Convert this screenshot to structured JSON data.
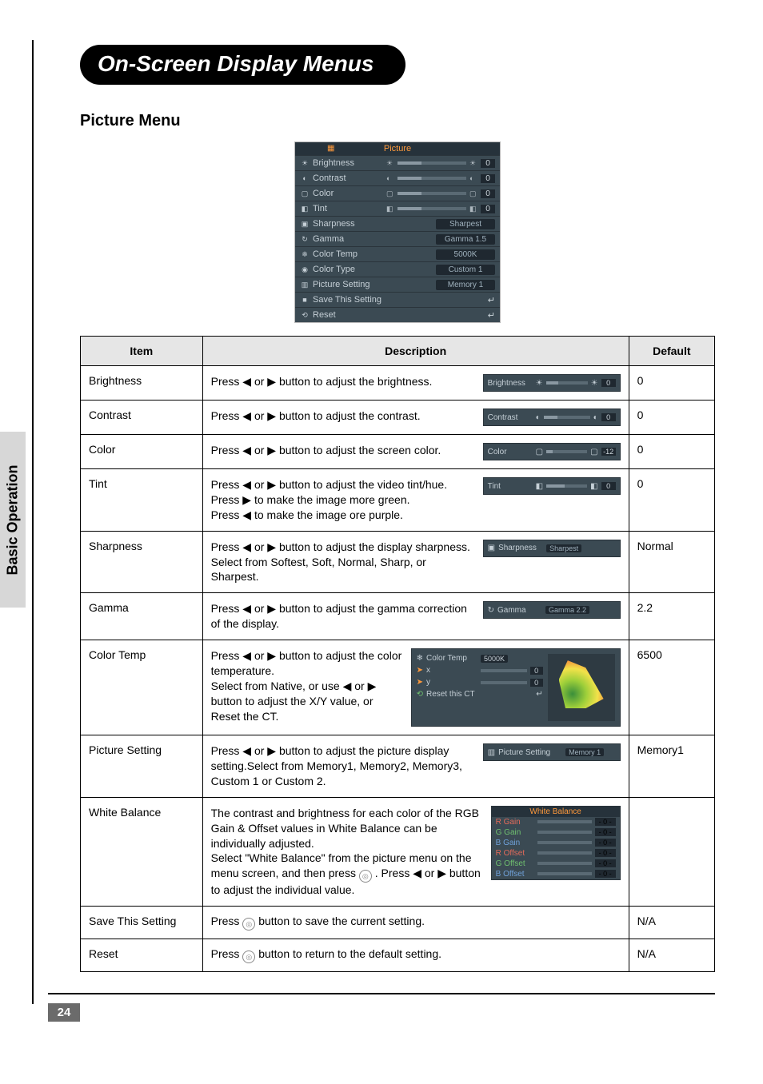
{
  "side_tab": "Basic Operation",
  "heading": "On-Screen Display Menus",
  "section": "Picture Menu",
  "page_number": "24",
  "icons": {
    "left": "◀",
    "right": "▶",
    "enter": "↵",
    "sun": "☀",
    "contrast": "◐",
    "square": "▢",
    "tint": "◧",
    "sharp": "▣",
    "gamma": "↻",
    "temp": "❄",
    "type": "◉",
    "setting": "▥",
    "save": "■",
    "reset": "⟲",
    "ok_circle": "◎"
  },
  "osd": {
    "title": "Picture",
    "rows": [
      {
        "kind": "slider",
        "iconL": "☀",
        "label": "Brightness",
        "iconR": "☀",
        "value": "0"
      },
      {
        "kind": "slider",
        "iconL": "◐",
        "label": "Contrast",
        "iconR": "◐",
        "value": "0"
      },
      {
        "kind": "slider",
        "iconL": "▢",
        "label": "Color",
        "iconR": "▢",
        "value": "0"
      },
      {
        "kind": "slider",
        "iconL": "◧",
        "label": "Tint",
        "iconR": "◧",
        "value": "0"
      },
      {
        "kind": "pill",
        "iconL": "▣",
        "label": "Sharpness",
        "pill": "Sharpest"
      },
      {
        "kind": "pill",
        "iconL": "↻",
        "label": "Gamma",
        "pill": "Gamma 1.5"
      },
      {
        "kind": "pill",
        "iconL": "❄",
        "label": "Color Temp",
        "pill": "5000K"
      },
      {
        "kind": "pill",
        "iconL": "◉",
        "label": "Color Type",
        "pill": "Custom 1"
      },
      {
        "kind": "pill",
        "iconL": "▥",
        "label": "Picture Setting",
        "pill": "Memory 1"
      },
      {
        "kind": "enter",
        "iconL": "■",
        "label": "Save This Setting"
      },
      {
        "kind": "enter",
        "iconL": "⟲",
        "label": "Reset"
      }
    ]
  },
  "table": {
    "headers": {
      "item": "Item",
      "desc": "Description",
      "def": "Default"
    },
    "rows": {
      "brightness": {
        "item": "Brightness",
        "desc": "Press ◀ or ▶ button to adjust the brightness.",
        "mini": {
          "label": "Brightness",
          "value": "0",
          "type": "slider"
        },
        "def": "0"
      },
      "contrast": {
        "item": "Contrast",
        "desc": "Press ◀ or ▶ button to adjust the contrast.",
        "mini": {
          "label": "Contrast",
          "value": "0",
          "type": "slider"
        },
        "def": "0"
      },
      "color": {
        "item": "Color",
        "desc": "Press ◀ or ▶ button to adjust the screen color.",
        "mini": {
          "label": "Color",
          "value": "-12",
          "type": "slider"
        },
        "def": "0"
      },
      "tint": {
        "item": "Tint",
        "desc": "Press ◀ or ▶ button to adjust the video tint/hue.\nPress ▶ to make the image more green.\nPress ◀ to make the image ore purple.",
        "mini": {
          "label": "Tint",
          "value": "0",
          "type": "slider"
        },
        "def": "0"
      },
      "sharpness": {
        "item": "Sharpness",
        "desc": "Press ◀ or ▶ button to adjust the display sharpness.\nSelect from Softest, Soft, Normal, Sharp, or Sharpest.",
        "mini": {
          "label": "Sharpness",
          "pill": "Sharpest",
          "type": "pill"
        },
        "def": "Normal"
      },
      "gamma": {
        "item": "Gamma",
        "desc": "Press ◀ or ▶ button to adjust the gamma correction of the display.",
        "mini": {
          "label": "Gamma",
          "pill": "Gamma 2.2",
          "type": "pill"
        },
        "def": "2.2"
      },
      "colortemp": {
        "item": "Color Temp",
        "desc": "Press ◀ or ▶ button to adjust the color temperature.\nSelect from Native, or use ◀ or ▶ button to adjust the X/Y value, or Reset the CT.",
        "def": "6500",
        "ct": {
          "row1": {
            "label": "Color Temp",
            "pill": "5000K"
          },
          "row2": {
            "label": "x",
            "value": "0"
          },
          "row3": {
            "label": "y",
            "value": "0"
          },
          "row4": {
            "label": "Reset this CT"
          }
        }
      },
      "picset": {
        "item": "Picture Setting",
        "desc": "Press ◀ or ▶ button to adjust the picture display setting.Select from Memory1, Memory2, Memory3, Custom 1 or Custom 2.",
        "mini": {
          "label": "Picture Setting",
          "pill": "Memory 1",
          "type": "pill"
        },
        "def": "Memory1"
      },
      "whitebalance": {
        "item": "White Balance",
        "desc_a": "The contrast and brightness for each color of the RGB Gain & Offset values in White Balance can be individually adjusted.\nSelect \"White Balance\" from the picture menu on the",
        "desc_b": "menu screen, and then press ",
        "desc_c": ". Press ◀ or ▶ button to adjust the individual value.",
        "wb": {
          "title": "White Balance",
          "rows": [
            {
              "label": "R Gain",
              "cls": "wb-r",
              "value": "- 0 -"
            },
            {
              "label": "G Gain",
              "cls": "wb-g",
              "value": "- 0 -"
            },
            {
              "label": "B Gain",
              "cls": "wb-b",
              "value": "- 0 -"
            },
            {
              "label": "R Offset",
              "cls": "wb-r",
              "value": "- 0 -"
            },
            {
              "label": "G Offset",
              "cls": "wb-g",
              "value": "- 0 -"
            },
            {
              "label": "B Offset",
              "cls": "wb-b",
              "value": "- 0 -"
            }
          ]
        },
        "def": ""
      },
      "savesetting": {
        "item": "Save This Setting",
        "desc_a": "Press ",
        "desc_b": " button to save the current setting.",
        "def": "N/A"
      },
      "reset": {
        "item": "Reset",
        "desc_a": "Press ",
        "desc_b": " button to return to the default setting.",
        "def": "N/A"
      }
    }
  }
}
